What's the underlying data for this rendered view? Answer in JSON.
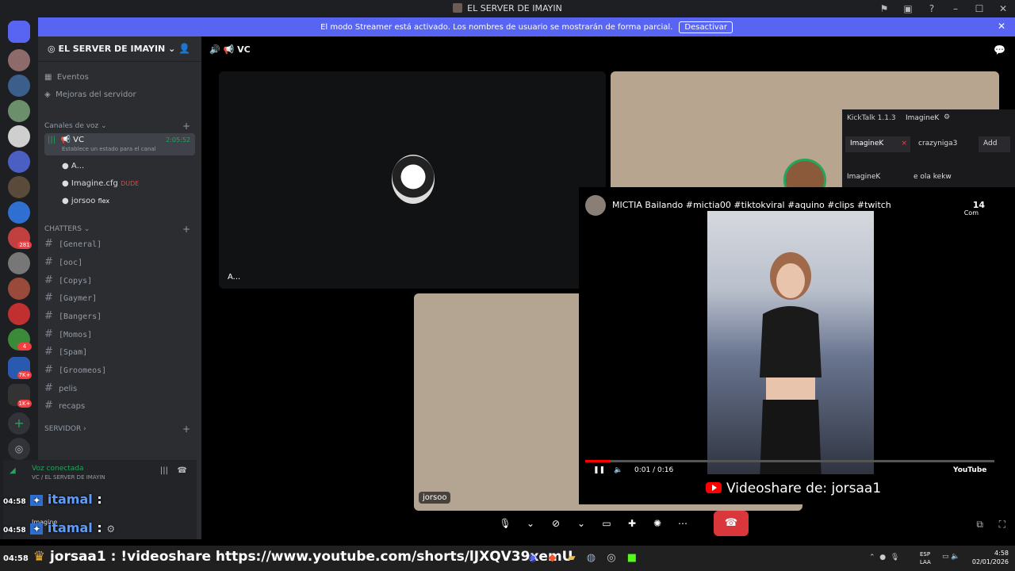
{
  "window": {
    "title": "EL SERVER DE IMAYIN"
  },
  "banner": {
    "message": "El modo Streamer está activado. Los nombres de usuario se mostrarán de forma parcial.",
    "button": "Desactivar"
  },
  "guild_badges": [
    "281",
    "4",
    "7K+",
    "1K+"
  ],
  "server": {
    "name": "EL SERVER DE IMAYIN",
    "top_items": [
      {
        "label": "Eventos"
      },
      {
        "label": "Mejoras del servidor"
      }
    ],
    "voice_category": "Canales de voz",
    "voice_channel": {
      "name": "VC",
      "timer": "2:05:52",
      "status": "Establece un estado para el canal"
    },
    "voice_users": [
      {
        "name": "A...",
        "tag": ""
      },
      {
        "name": "Imagine.cfg",
        "tag": "DUDE"
      },
      {
        "name": "jorsoo",
        "tag": "flex"
      }
    ],
    "chatters_category": "CHATTERS",
    "text_channels": [
      "[General]",
      "[ooc]",
      "[Copys]",
      "[Gaymer]",
      "[Bangers]",
      "[Momos]",
      "[Spam]",
      "[Groomeos]",
      "pelis",
      "recaps"
    ],
    "servidor_category": "SERVIDOR"
  },
  "user_panel": {
    "status": "Voz conectada",
    "location": "VC / EL SERVER DE IMAYIN",
    "username": "Imagine"
  },
  "main": {
    "vc_title": "VC",
    "tile_labels": {
      "a": "A...",
      "jorsoo": "jorsoo"
    }
  },
  "kicktalk": {
    "app": "KickTalk 1.1.3",
    "account": "ImagineK",
    "tabs": [
      "ImagineK",
      "crazyniga3"
    ],
    "add_label": "Add",
    "chat_user": "ImagineK",
    "chat_msg": "e ola kekw"
  },
  "video": {
    "title": "MICTIA Bailando #mictia00 #tiktokviral #aquino #clips #twitch",
    "shares": "14",
    "share_label": "Com",
    "time": "0:01 / 0:16",
    "progress_fraction": 0.06,
    "platform": "YouTube",
    "share_caption": "Videoshare de: jorsaa1"
  },
  "overlay_chat": [
    {
      "time": "04:58",
      "user": "itamal",
      "sep": ":"
    },
    {
      "time": "04:58",
      "user": "itamal",
      "sep": ":"
    }
  ],
  "taskbar": {
    "time_prefix": "04:58",
    "chat_line": "jorsaa1 : !videoshare https://www.youtube.com/shorts/lJXQV39xemU",
    "lang": "ESP",
    "lang2": "LAA",
    "clock": "4:58",
    "date": "02/01/2026"
  }
}
